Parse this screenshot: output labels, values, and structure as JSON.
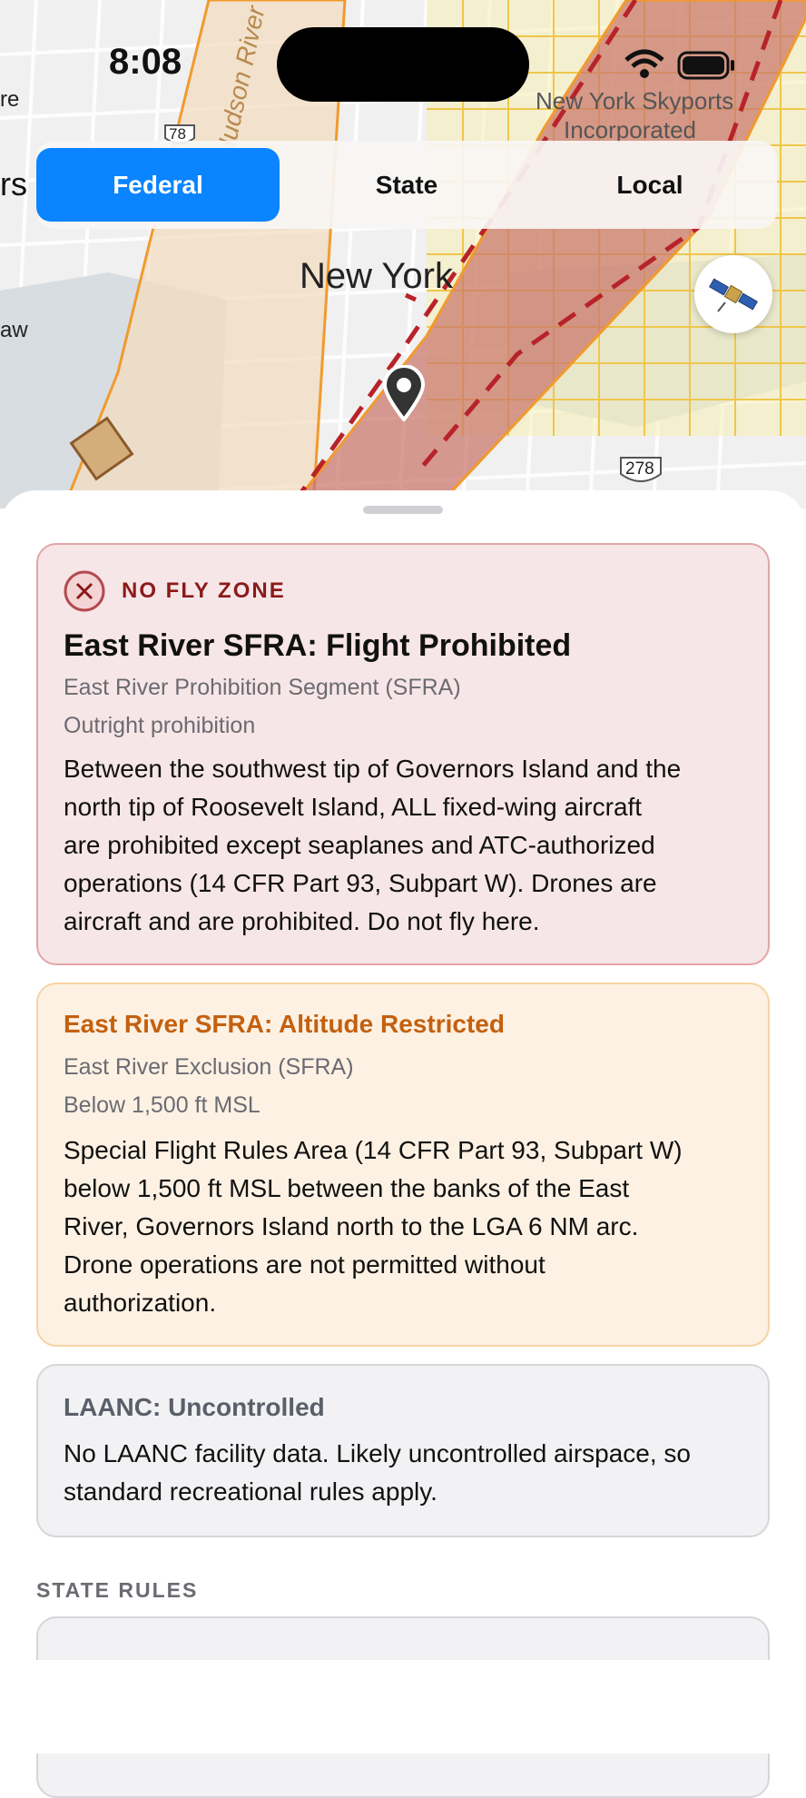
{
  "status_bar": {
    "time": "8:08"
  },
  "map": {
    "labels": {
      "new_york": "New York",
      "skyports": [
        "New York Skyports",
        "Incorporated"
      ],
      "river": "Hudson River",
      "route_78": "78",
      "route_278": "278",
      "edge_re": "re",
      "edge_rs": "rs",
      "edge_aw": "aw"
    },
    "icons": {
      "location_pin": "location-pin-icon",
      "satellite": "satellite-icon",
      "airport": "airport-icon"
    },
    "colors": {
      "zone_fill": "#c9766b",
      "zone_border": "#b8232a",
      "orange_border": "#f19a2e",
      "grid": "#efc64c"
    }
  },
  "tabs": {
    "items": [
      {
        "label": "Federal",
        "active": true
      },
      {
        "label": "State",
        "active": false
      },
      {
        "label": "Local",
        "active": false
      }
    ],
    "accent": "#0a84ff"
  },
  "cards": {
    "no_fly": {
      "badge": "NO FLY ZONE",
      "icon": "close-circle-icon",
      "title": "East River SFRA: Flight Prohibited",
      "subtitle": "East River Prohibition Segment (SFRA)",
      "detail": "Outright prohibition",
      "description_lines": [
        "Between the southwest tip of Governors Island and the",
        "north tip of Roosevelt Island, ALL fixed-wing aircraft",
        "are prohibited except seaplanes and ATC-authorized",
        "operations (14 CFR Part 93, Subpart W). Drones are",
        "aircraft and are prohibited. Do not fly here."
      ],
      "color": "#8b1a1a"
    },
    "restricted": {
      "title": "East River SFRA: Altitude Restricted",
      "subtitle": "East River Exclusion (SFRA)",
      "detail": "Below 1,500 ft MSL",
      "description_lines": [
        "Special Flight Rules Area (14 CFR Part 93, Subpart W)",
        "below 1,500 ft MSL between the banks of the East",
        "River, Governors Island north to the LGA 6 NM arc.",
        "Drone operations are not permitted without",
        "authorization."
      ],
      "color": "#c4600e"
    },
    "laanc": {
      "title": "LAANC: Uncontrolled",
      "description_lines": [
        "No LAANC facility data. Likely uncontrolled airspace, so",
        "standard recreational rules apply."
      ]
    }
  },
  "sections": {
    "state_rules": "STATE RULES"
  }
}
